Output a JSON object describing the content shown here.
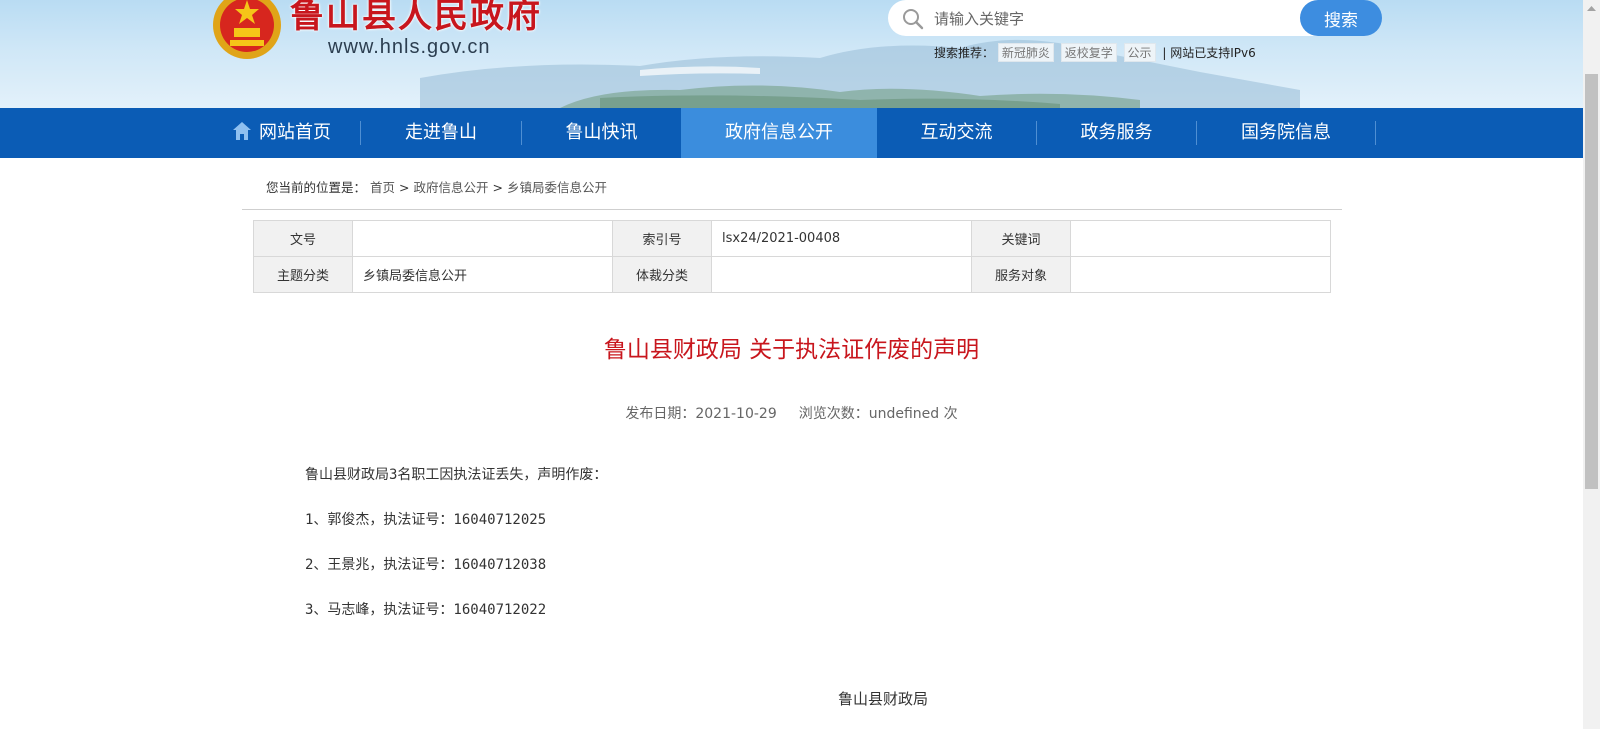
{
  "header": {
    "site_name": "鲁山县人民政府",
    "site_url": "www.hnls.gov.cn",
    "search": {
      "placeholder": "请输入关键字",
      "button_label": "搜索",
      "recommend_label": "搜索推荐：",
      "tags": [
        "新冠肺炎",
        "返校复学",
        "公示"
      ],
      "ipv6_note": "| 网站已支持IPv6"
    }
  },
  "nav": {
    "items": [
      {
        "label": "网站首页"
      },
      {
        "label": "走进鲁山"
      },
      {
        "label": "鲁山快讯"
      },
      {
        "label": "政府信息公开"
      },
      {
        "label": "互动交流"
      },
      {
        "label": "政务服务"
      },
      {
        "label": "国务院信息"
      }
    ],
    "active_index": 3
  },
  "breadcrumb": {
    "prefix": "您当前的位置是：",
    "items": [
      "首页",
      "政府信息公开",
      "乡镇局委信息公开"
    ],
    "separator": ">"
  },
  "info_table": {
    "rows": [
      [
        {
          "label": "文号",
          "value": ""
        },
        {
          "label": "索引号",
          "value": "lsx24/2021-00408"
        },
        {
          "label": "关键词",
          "value": ""
        }
      ],
      [
        {
          "label": "主题分类",
          "value": "乡镇局委信息公开"
        },
        {
          "label": "体裁分类",
          "value": ""
        },
        {
          "label": "服务对象",
          "value": ""
        }
      ]
    ]
  },
  "article": {
    "title": "鲁山县财政局 关于执法证作废的声明",
    "publish_label": "发布日期：",
    "publish_date": "2021-10-29",
    "views_label": "浏览次数：",
    "views_value": "undefined",
    "views_unit": "次",
    "body": [
      "鲁山县财政局3名职工因执法证丢失，声明作废：",
      "1、郭俊杰，执法证号：16040712025",
      "2、王景兆，执法证号：16040712038",
      "3、马志峰，执法证号：16040712022"
    ],
    "signature": "鲁山县财政局"
  },
  "colors": {
    "brand_red": "#c8161d",
    "nav_blue": "#0b5cb5",
    "nav_active": "#3b8ddd",
    "search_button": "#3d8de0"
  }
}
